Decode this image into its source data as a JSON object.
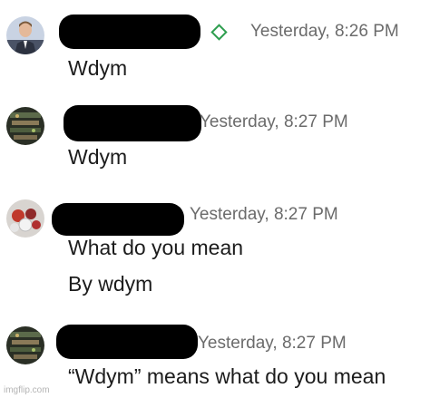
{
  "messages": [
    {
      "avatar": "profile-photo-man-in-suit",
      "time": "Yesterday, 8:26 PM",
      "badge_icon": "green-diamond-icon",
      "lines": [
        "Wdym"
      ]
    },
    {
      "avatar": "profile-photo-dark-scene",
      "time": "Yesterday, 8:27 PM",
      "lines": [
        "Wdym"
      ]
    },
    {
      "avatar": "profile-photo-balls",
      "time": "Yesterday, 8:27 PM",
      "lines": [
        "What do you mean",
        "By wdym"
      ]
    },
    {
      "avatar": "profile-photo-dark-scene",
      "time": "Yesterday, 8:27 PM",
      "lines": [
        "“Wdym” means what do you mean"
      ]
    }
  ],
  "watermark": "imgflip.com",
  "colors": {
    "badge": "#2e9e4f",
    "timestamp": "#6b6b6b",
    "text": "#1c1c1c"
  }
}
